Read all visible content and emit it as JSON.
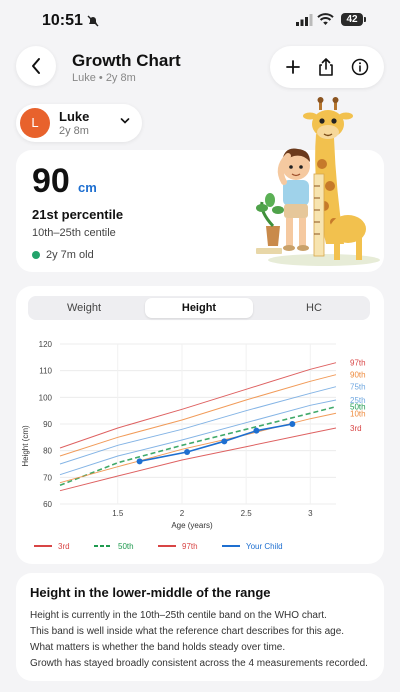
{
  "status": {
    "time": "10:51",
    "battery": "42"
  },
  "header": {
    "title": "Growth Chart",
    "subtitle": "Luke • 2y 8m"
  },
  "child": {
    "initial": "L",
    "name": "Luke",
    "age": "2y 8m"
  },
  "summary": {
    "value": "90",
    "unit": "cm",
    "percentile": "21st percentile",
    "band": "10th–25th centile",
    "age_measured": "2y 7m old"
  },
  "tabs": [
    {
      "label": "Weight"
    },
    {
      "label": "Height"
    },
    {
      "label": "HC"
    }
  ],
  "active_tab": "Height",
  "colors": {
    "p97": "#d84545",
    "p90": "#ee8a3c",
    "p75": "#6fa7e0",
    "p50": "#1f9a4f",
    "p25": "#6fa7e0",
    "p10": "#ee8a3c",
    "p3": "#d84545",
    "child": "#1e6fd0"
  },
  "chart_data": {
    "type": "line",
    "xlabel": "Age (years)",
    "ylabel": "Height (cm)",
    "xlim": [
      1.05,
      3.2
    ],
    "ylim": [
      60,
      120
    ],
    "xticks": [
      1.5,
      2,
      2.5,
      3
    ],
    "yticks": [
      60,
      70,
      80,
      90,
      100,
      110,
      120
    ],
    "series": [
      {
        "name": "97th",
        "x": [
          1.05,
          1.5,
          2,
          2.5,
          3,
          3.2
        ],
        "values": [
          81,
          88.5,
          95.5,
          103,
          110.5,
          113
        ]
      },
      {
        "name": "90th",
        "x": [
          1.05,
          1.5,
          2,
          2.5,
          3,
          3.2
        ],
        "values": [
          78,
          85,
          91.5,
          99,
          106,
          108.5
        ]
      },
      {
        "name": "75th",
        "x": [
          1.05,
          1.5,
          2,
          2.5,
          3,
          3.2
        ],
        "values": [
          75,
          82,
          88,
          95,
          101.5,
          104
        ]
      },
      {
        "name": "50th",
        "x": [
          1.05,
          1.5,
          2,
          2.5,
          3,
          3.2
        ],
        "values": [
          67,
          75.5,
          82,
          88,
          94,
          96.5
        ]
      },
      {
        "name": "25th",
        "x": [
          1.05,
          1.5,
          2,
          2.5,
          3,
          3.2
        ],
        "values": [
          71,
          78,
          84,
          90.5,
          97,
          99
        ]
      },
      {
        "name": "10th",
        "x": [
          1.05,
          1.5,
          2,
          2.5,
          3,
          3.2
        ],
        "values": [
          68,
          74,
          80.5,
          86,
          92,
          94
        ]
      },
      {
        "name": "3rd",
        "x": [
          1.05,
          1.5,
          2,
          2.5,
          3,
          3.2
        ],
        "values": [
          65,
          70.5,
          76.5,
          81.5,
          86.5,
          88.5
        ]
      },
      {
        "name": "Your Child",
        "x": [
          1.67,
          2.04,
          2.33,
          2.58,
          2.86
        ],
        "values": [
          76,
          79.5,
          83.5,
          87.5,
          90
        ]
      }
    ],
    "legend": [
      "3rd",
      "50th",
      "97th",
      "Your Child"
    ]
  },
  "explanation": {
    "title": "Height in the lower-middle of the range",
    "lines": [
      "Height is currently in the 10th–25th centile band on the WHO chart.",
      "This band is well inside what the reference chart describes for this age.",
      "What matters is whether the band holds steady over time.",
      "Growth has stayed broadly consistent across the 4 measurements recorded."
    ]
  }
}
